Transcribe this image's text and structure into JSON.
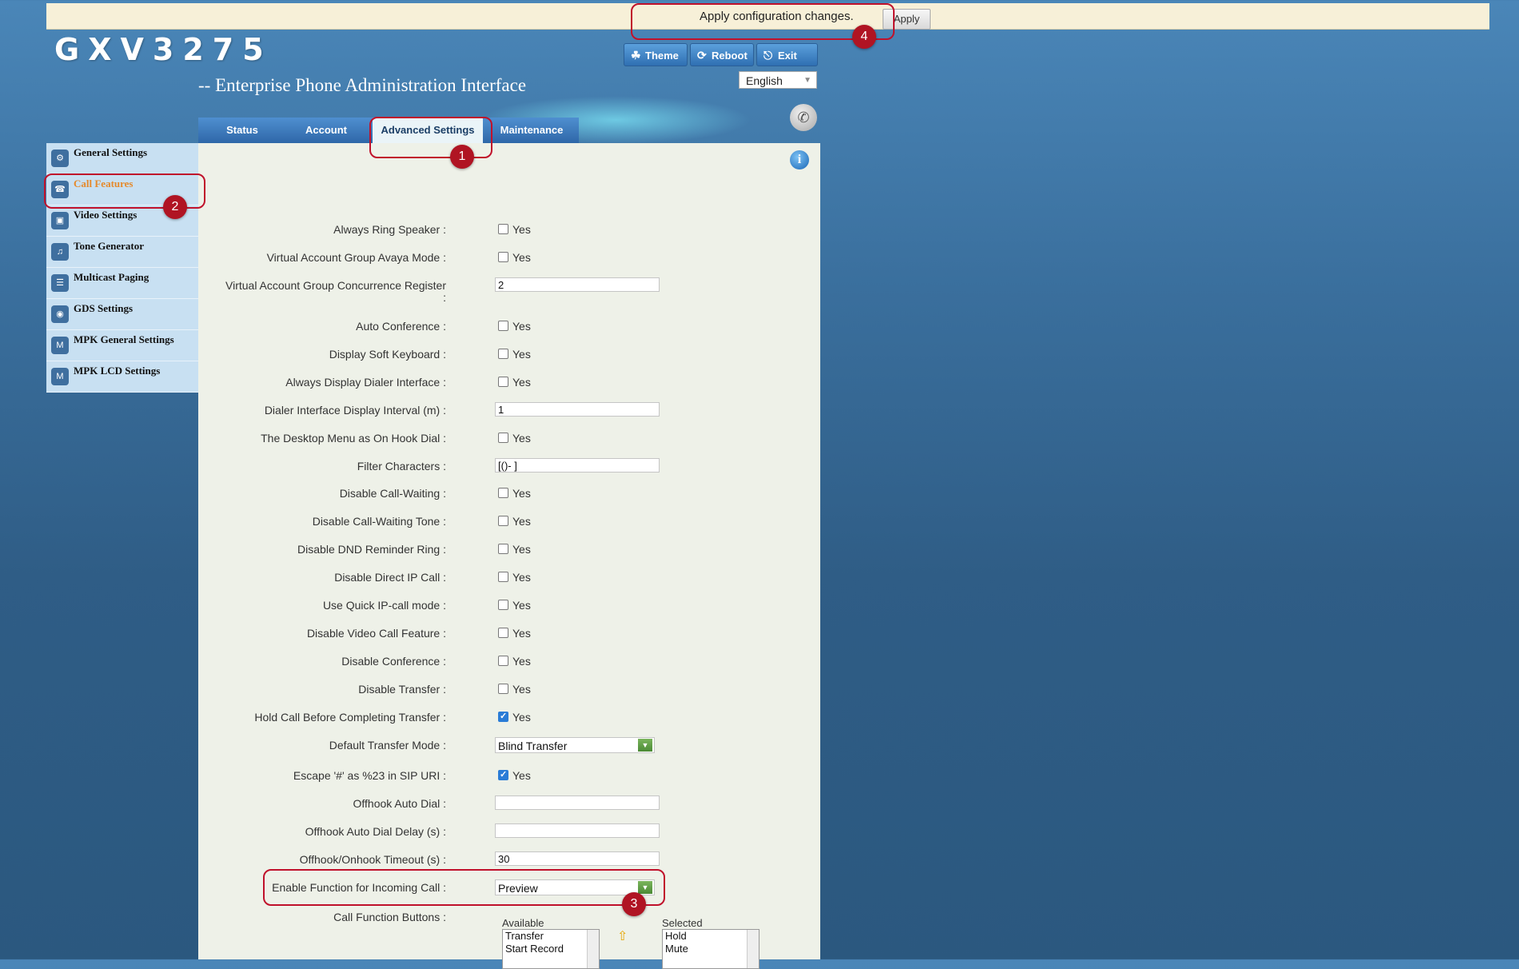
{
  "notice": {
    "text": "Apply configuration changes.",
    "apply_label": "Apply"
  },
  "header": {
    "product": "GXV3275",
    "subtitle": "-- Enterprise Phone Administration Interface",
    "buttons": [
      {
        "label": "Theme",
        "icon": "theme-icon"
      },
      {
        "label": "Reboot",
        "icon": "reboot-icon"
      },
      {
        "label": "Exit",
        "icon": "exit-icon"
      }
    ],
    "language": "English"
  },
  "tabs": [
    "Status",
    "Account",
    "Advanced Settings",
    "Maintenance"
  ],
  "active_tab": "Advanced Settings",
  "sidebar": {
    "items": [
      {
        "label": "General Settings",
        "icon": "gear-icon"
      },
      {
        "label": "Call Features",
        "icon": "call-features-icon",
        "active": true
      },
      {
        "label": "Video Settings",
        "icon": "video-icon"
      },
      {
        "label": "Tone Generator",
        "icon": "music-note-icon"
      },
      {
        "label": "Multicast Paging",
        "icon": "paging-icon"
      },
      {
        "label": "GDS Settings",
        "icon": "gds-icon"
      },
      {
        "label": "MPK General Settings",
        "icon": "mpk-icon"
      },
      {
        "label": "MPK LCD Settings",
        "icon": "mpk-icon"
      }
    ]
  },
  "form": {
    "yes_label": "Yes",
    "rows": [
      {
        "label": "Always Ring Speaker :",
        "type": "checkbox",
        "checked": false
      },
      {
        "label": "Virtual Account Group Avaya Mode :",
        "type": "checkbox",
        "checked": false
      },
      {
        "label": "Virtual Account Group Concurrence Register",
        "label2": ":",
        "type": "text",
        "value": "2"
      },
      {
        "label": "Auto Conference :",
        "type": "checkbox",
        "checked": false
      },
      {
        "label": "Display Soft Keyboard :",
        "type": "checkbox",
        "checked": false
      },
      {
        "label": "Always Display Dialer Interface :",
        "type": "checkbox",
        "checked": false
      },
      {
        "label": "Dialer Interface Display Interval (m) :",
        "type": "text",
        "value": "1"
      },
      {
        "label": "The Desktop Menu as On Hook Dial :",
        "type": "checkbox",
        "checked": false
      },
      {
        "label": "Filter Characters :",
        "type": "text",
        "value": "[()- ]"
      },
      {
        "label": "Disable Call-Waiting :",
        "type": "checkbox",
        "checked": false
      },
      {
        "label": "Disable Call-Waiting Tone :",
        "type": "checkbox",
        "checked": false
      },
      {
        "label": "Disable DND Reminder Ring :",
        "type": "checkbox",
        "checked": false
      },
      {
        "label": "Disable Direct IP Call :",
        "type": "checkbox",
        "checked": false
      },
      {
        "label": "Use Quick IP-call mode :",
        "type": "checkbox",
        "checked": false
      },
      {
        "label": "Disable Video Call Feature :",
        "type": "checkbox",
        "checked": false
      },
      {
        "label": "Disable Conference :",
        "type": "checkbox",
        "checked": false
      },
      {
        "label": "Disable Transfer :",
        "type": "checkbox",
        "checked": false
      },
      {
        "label": "Hold Call Before Completing Transfer :",
        "type": "checkbox",
        "checked": true
      },
      {
        "label": "Default Transfer Mode :",
        "type": "select",
        "value": "Blind Transfer"
      },
      {
        "label": "Escape '#' as %23 in SIP URI :",
        "type": "checkbox",
        "checked": true
      },
      {
        "label": "Offhook Auto Dial :",
        "type": "text",
        "value": ""
      },
      {
        "label": "Offhook Auto Dial Delay (s) :",
        "type": "text",
        "value": ""
      },
      {
        "label": "Offhook/Onhook Timeout (s) :",
        "type": "text",
        "value": "30"
      },
      {
        "label": "Enable Function for Incoming Call :",
        "type": "select",
        "value": "Preview"
      },
      {
        "label": "Call Function Buttons :",
        "type": "lists"
      }
    ],
    "available_label": "Available",
    "available_items": [
      "Transfer",
      "Start Record"
    ],
    "selected_label": "Selected",
    "selected_items": [
      "Hold",
      "Mute"
    ]
  },
  "callouts": [
    "1",
    "2",
    "3",
    "4"
  ],
  "colors": {
    "accent": "#c0112b",
    "active_sidebar": "#e58a2c"
  }
}
